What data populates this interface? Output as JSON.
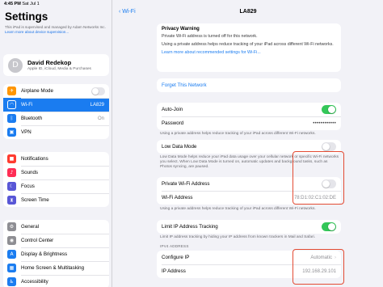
{
  "status": {
    "time": "4:45 PM",
    "date": "Sat Jul 1"
  },
  "left": {
    "title": "Settings",
    "supervised_text": "This iPad is supervised and managed by Adam Networks Inc.",
    "supervised_link": "Learn more about device supervision...",
    "profile": {
      "name": "David Redekop",
      "sub": "Apple ID, iCloud, Media & Purchases",
      "initials": "D"
    },
    "group1": [
      {
        "label": "Airplane Mode",
        "color": "#ff9500",
        "glyph": "✈",
        "value": ""
      },
      {
        "label": "Wi-Fi",
        "color": "#1a7cf0",
        "glyph": "◠",
        "value": "LA829"
      },
      {
        "label": "Bluetooth",
        "color": "#1a7cf0",
        "glyph": "ᛒ",
        "value": "On"
      },
      {
        "label": "VPN",
        "color": "#1a7cf0",
        "glyph": "▣",
        "value": ""
      }
    ],
    "group2": [
      {
        "label": "Notifications",
        "color": "#ff3b30",
        "glyph": "■"
      },
      {
        "label": "Sounds",
        "color": "#ff2d55",
        "glyph": "♪"
      },
      {
        "label": "Focus",
        "color": "#5856d6",
        "glyph": "☾"
      },
      {
        "label": "Screen Time",
        "color": "#5856d6",
        "glyph": "⧗"
      }
    ],
    "group3": [
      {
        "label": "General",
        "color": "#8e8e93",
        "glyph": "⚙"
      },
      {
        "label": "Control Center",
        "color": "#8e8e93",
        "glyph": "◉"
      },
      {
        "label": "Display & Brightness",
        "color": "#1a7cf0",
        "glyph": "A"
      },
      {
        "label": "Home Screen & Multitasking",
        "color": "#1a7cf0",
        "glyph": "▦"
      },
      {
        "label": "Accessibility",
        "color": "#1a7cf0",
        "glyph": "♿"
      }
    ]
  },
  "right": {
    "back_label": "Wi-Fi",
    "title": "LA829",
    "privacy_warning": {
      "title": "Privacy Warning",
      "line1": "Private Wi-Fi address is turned off for this network.",
      "line2": "Using a private address helps reduce tracking of your iPad across different Wi-Fi networks.",
      "link": "Learn more about recommended settings for Wi-Fi..."
    },
    "forget_label": "Forget This Network",
    "auto_join_label": "Auto-Join",
    "auto_join_on": true,
    "password_label": "Password",
    "password_value": "••••••••••••",
    "private_note": "Using a private address helps reduce tracking of your iPad across different Wi-Fi networks.",
    "low_data_label": "Low Data Mode",
    "low_data_on": false,
    "low_data_note": "Low Data Mode helps reduce your iPad data usage over your cellular network or specific Wi-Fi networks you select. When Low Data Mode is turned on, automatic updates and background tasks, such as Photos syncing, are paused.",
    "private_addr_label": "Private Wi-Fi Address",
    "private_addr_on": false,
    "wifi_addr_label": "Wi-Fi Address",
    "wifi_addr_value": "78:D1:02:C1:02:DE",
    "private_addr_note": "Using a private address helps reduce tracking of your iPad across different Wi-Fi networks.",
    "limit_ip_label": "Limit IP Address Tracking",
    "limit_ip_on": true,
    "limit_ip_note": "Limit IP address tracking by hiding your IP address from known trackers in Mail and Safari.",
    "ipv4_caption": "IPV4 ADDRESS",
    "configure_ip_label": "Configure IP",
    "configure_ip_value": "Automatic",
    "ip_addr_label": "IP Address",
    "ip_addr_value": "192.168.29.101",
    "highlight_color": "#e34b33"
  }
}
